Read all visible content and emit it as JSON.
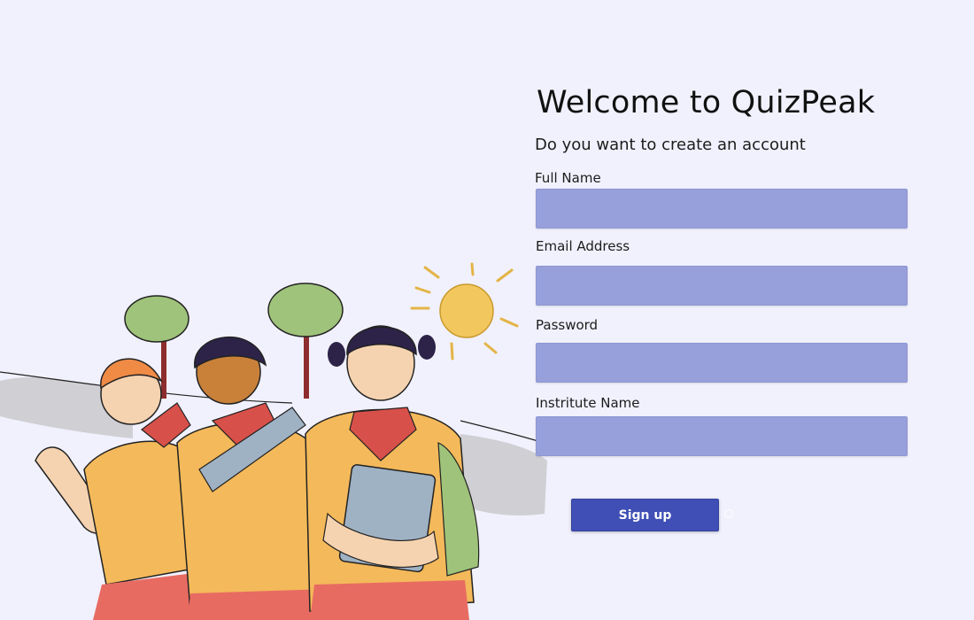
{
  "page": {
    "title": "Welcome to QuizPeak",
    "subtitle": "Do you want to create an account"
  },
  "form": {
    "full_name": {
      "label": "Full Name",
      "value": "",
      "placeholder": ""
    },
    "email": {
      "label": "Email Address",
      "value": "",
      "placeholder": ""
    },
    "password": {
      "label": "Password",
      "value": "",
      "placeholder": ""
    },
    "institute": {
      "label": "Instritute Name",
      "value": "",
      "placeholder": ""
    },
    "signup_label": "Sign up"
  },
  "colors": {
    "background": "#f1f1fd",
    "input_fill": "#97a0da",
    "button_fill": "#3f4fb5",
    "button_text": "#ffffff"
  },
  "illustration": {
    "subject": "three-school-children-with-trees-and-sun"
  }
}
